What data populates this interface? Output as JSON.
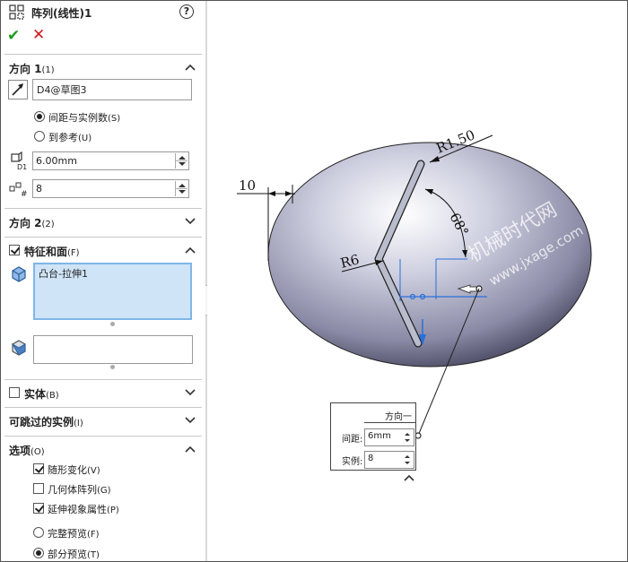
{
  "panel": {
    "title": "阵列(线性)1",
    "help_label": "?",
    "ok_label": "✔",
    "cancel_label": "✕",
    "direction1": {
      "title": "方向 1",
      "key": "(1)",
      "reference_value": "D4@草图3",
      "radio_spacing": "间距与实例数",
      "radio_spacing_key": "(S)",
      "radio_reference": "到参考",
      "radio_reference_key": "(U)",
      "spacing_value": "6.00mm",
      "instances_value": "8"
    },
    "direction2": {
      "title": "方向 2",
      "key": "(2)"
    },
    "features": {
      "title": "特征和面",
      "key": "(F)",
      "checked": true,
      "items": [
        "凸台-拉伸1"
      ]
    },
    "bodies": {
      "title": "实体",
      "key": "(B)",
      "checked": false
    },
    "skip": {
      "title": "可跳过的实例",
      "key": "(I)"
    },
    "options": {
      "title": "选项",
      "key": "(O)",
      "items": [
        {
          "label": "随形变化",
          "key": "(V)",
          "type": "checkbox",
          "checked": true
        },
        {
          "label": "几何体阵列",
          "key": "(G)",
          "type": "checkbox",
          "checked": false
        },
        {
          "label": "延伸视象属性",
          "key": "(P)",
          "type": "checkbox",
          "checked": true
        },
        {
          "label": "完整预览",
          "key": "(F)",
          "type": "radio",
          "checked": false
        },
        {
          "label": "部分预览",
          "key": "(T)",
          "type": "radio",
          "checked": true
        }
      ]
    }
  },
  "viewport": {
    "dim_top_radius": "R1.50",
    "dim_angle": "68°",
    "dim_left": "10",
    "dim_radius": "R6",
    "watermark_1": "机械时代网",
    "watermark_2": "www.jxage.com",
    "callout": {
      "title": "方向一",
      "spacing_label": "间距:",
      "spacing_value": "6mm",
      "instances_label": "实例:",
      "instances_value": "8"
    }
  },
  "colors": {
    "ok": "#1c9a1c",
    "cancel": "#d01818",
    "selection": "#cfe4f7",
    "sketch": "#2a6fdb"
  }
}
